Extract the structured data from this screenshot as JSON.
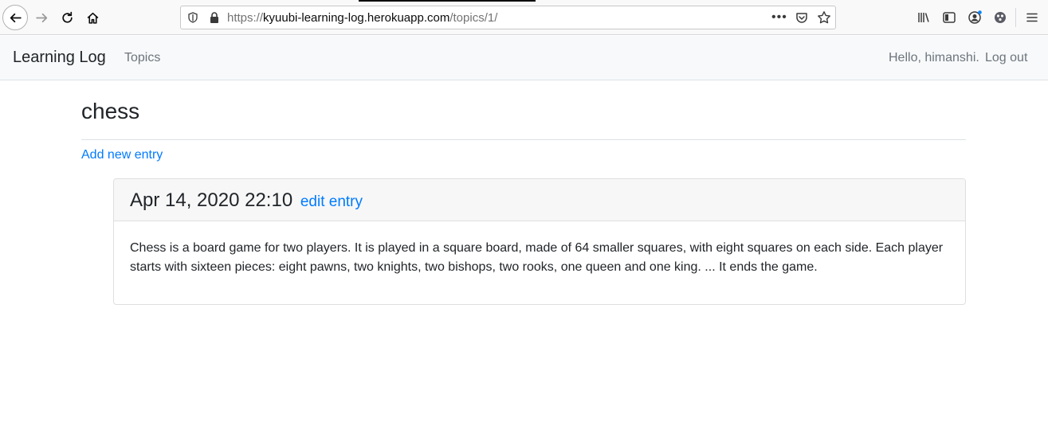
{
  "browser": {
    "url_scheme": "https://",
    "url_domain": "kyuubi-learning-log.herokuapp.com",
    "url_path": "/topics/1/",
    "page_actions": "•••"
  },
  "navbar": {
    "brand": "Learning Log",
    "topics": "Topics",
    "hello": "Hello, himanshi.",
    "logout": "Log out"
  },
  "topic": {
    "title": "chess",
    "add_entry": "Add new entry"
  },
  "entries": [
    {
      "date": "Apr 14, 2020 22:10",
      "edit_label": "edit entry",
      "text": "Chess is a board game for two players. It is played in a square board, made of 64 smaller squares, with eight squares on each side. Each player starts with sixteen pieces: eight pawns, two knights, two bishops, two rooks, one queen and one king. ... It ends the game."
    }
  ],
  "colors": {
    "link": "#007bff",
    "navbar_bg": "#f8f9fa",
    "muted": "#6c757d"
  }
}
